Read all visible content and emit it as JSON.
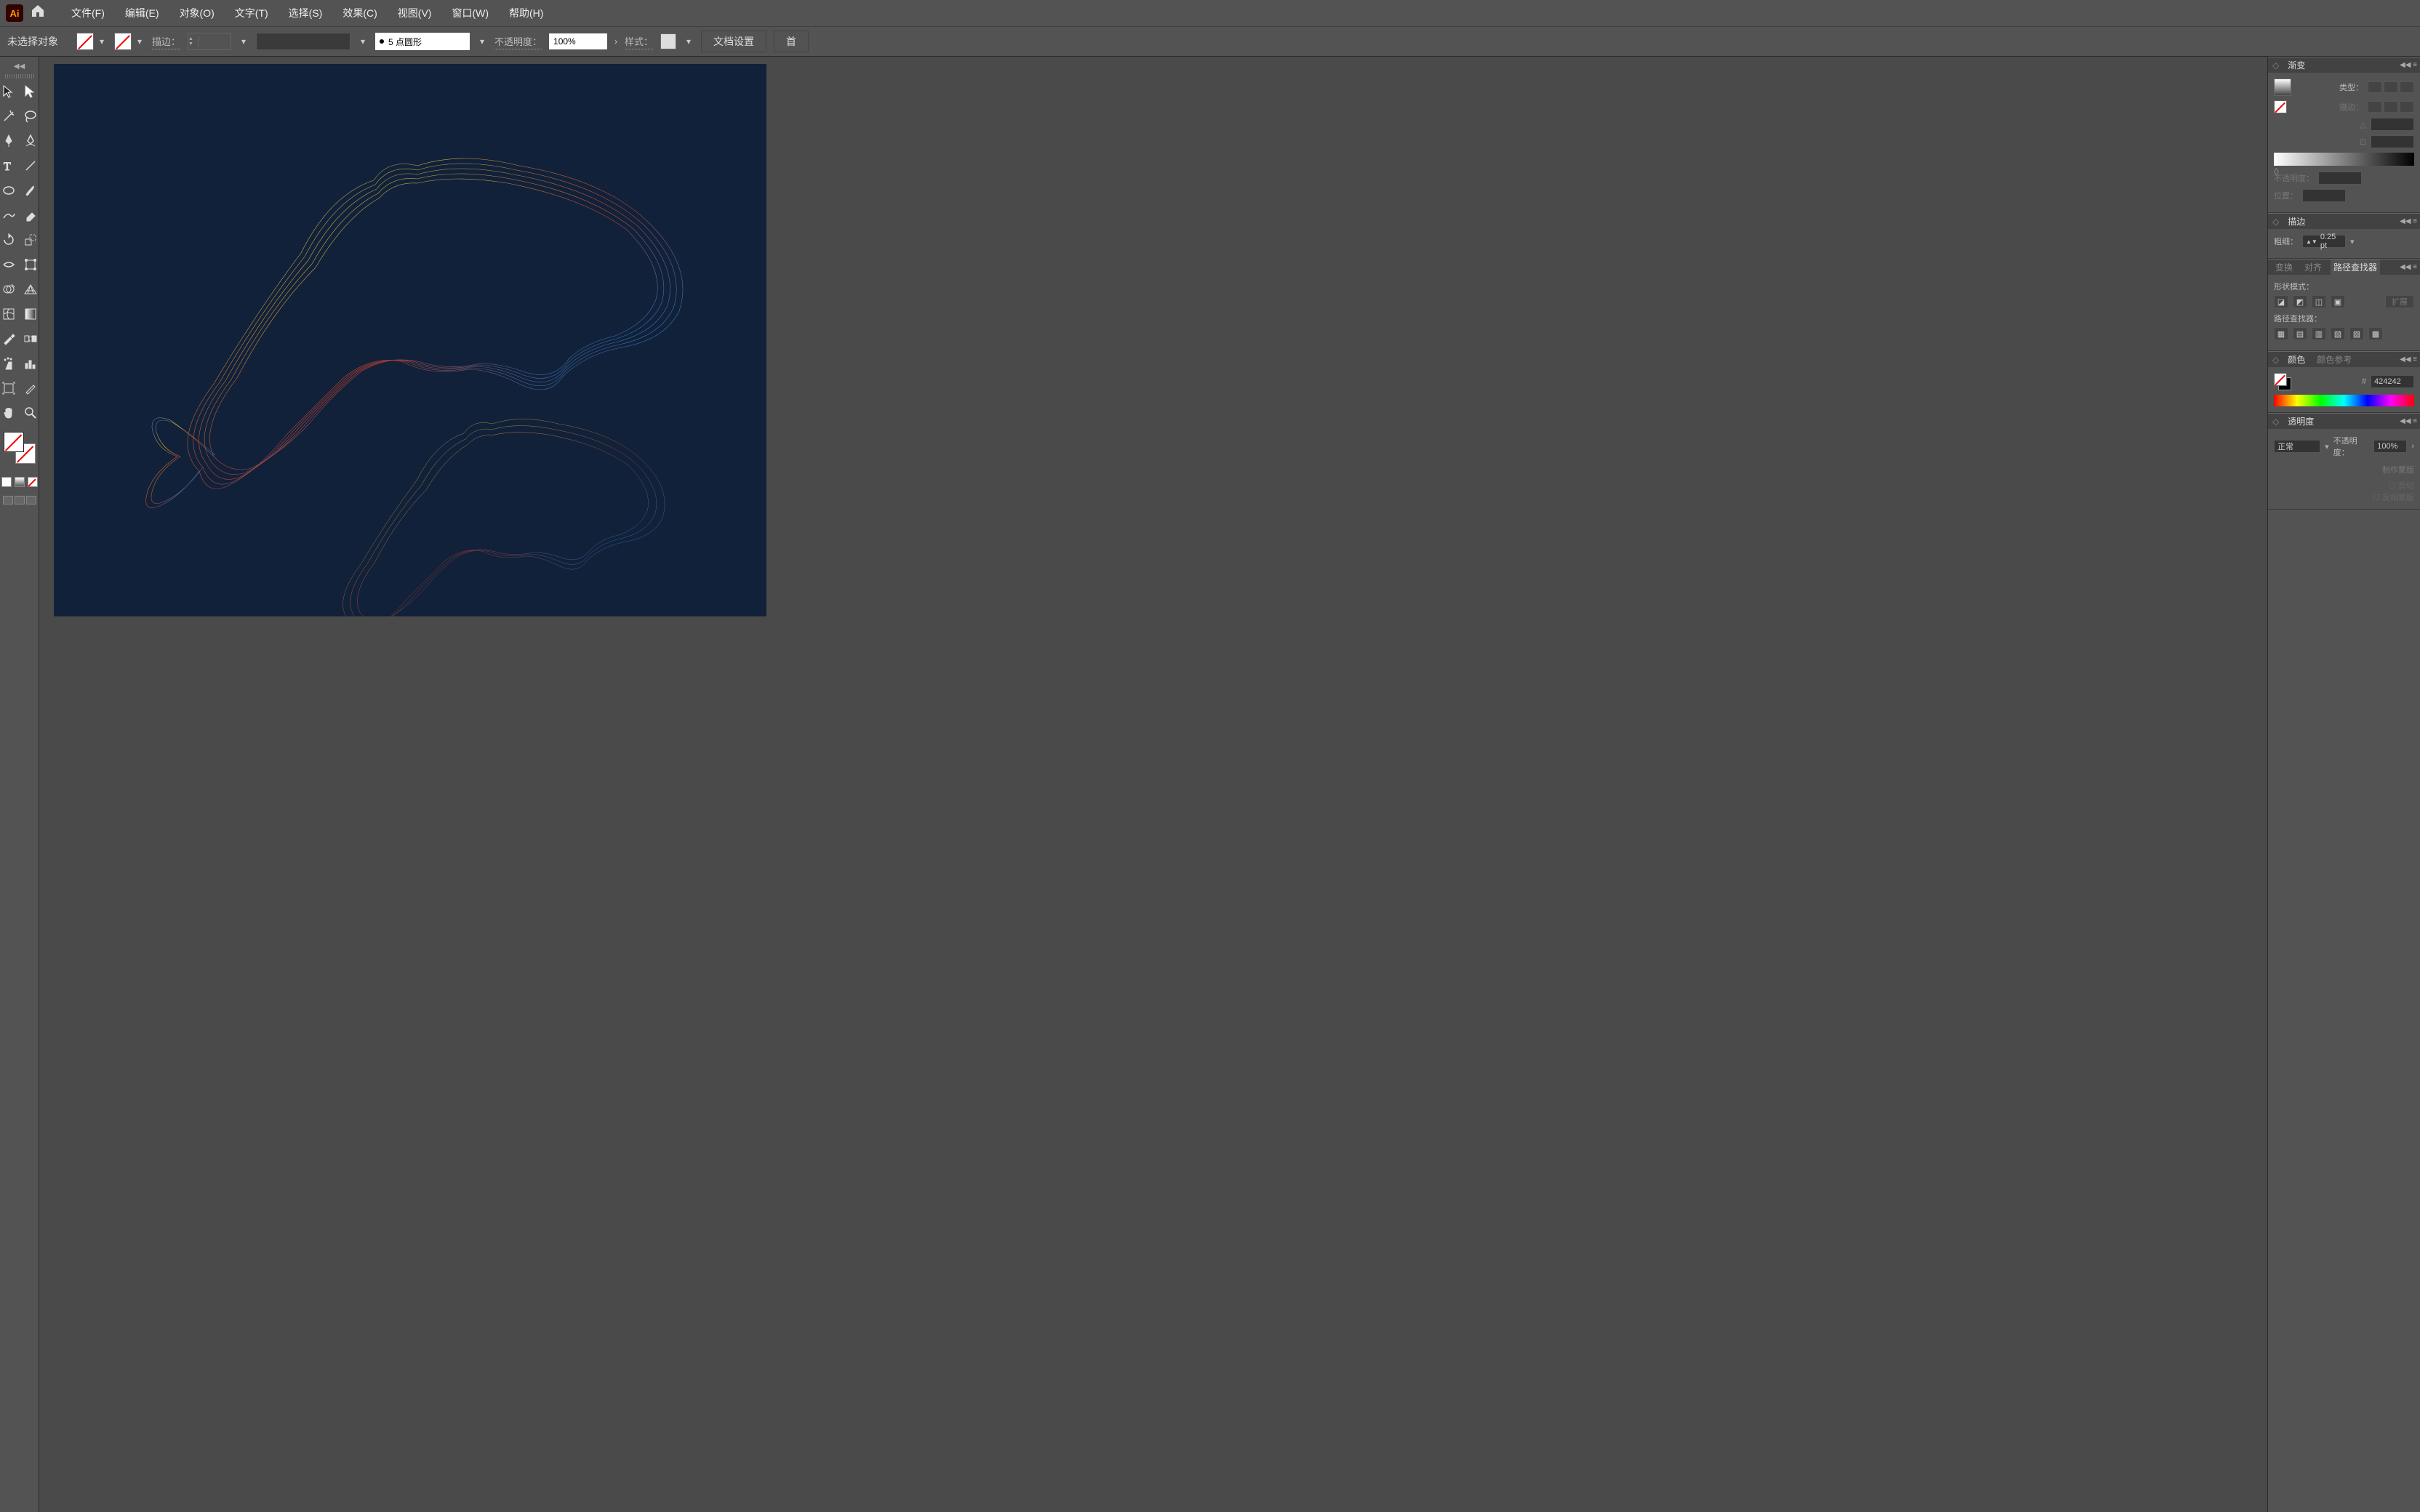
{
  "menu": {
    "items": [
      "文件(F)",
      "编辑(E)",
      "对象(O)",
      "文字(T)",
      "选择(S)",
      "效果(C)",
      "视图(V)",
      "窗口(W)",
      "帮助(H)"
    ]
  },
  "controlbar": {
    "noselection": "未选择对象",
    "stroke_label": "描边：",
    "brush_value": "5 点圆形",
    "opacity_label": "不透明度：",
    "opacity_value": "100%",
    "style_label": "样式：",
    "doc_setup": "文档设置",
    "prefs": "首"
  },
  "tools": {
    "names": [
      "selection-tool",
      "direct-selection-tool",
      "magic-wand-tool",
      "lasso-tool",
      "pen-tool",
      "curvature-tool",
      "type-tool",
      "line-tool",
      "ellipse-tool",
      "brush-tool",
      "shaper-tool",
      "eraser-tool",
      "rotate-tool",
      "scale-tool",
      "width-tool",
      "free-transform-tool",
      "shape-builder-tool",
      "perspective-tool",
      "mesh-tool",
      "gradient-tool",
      "eyedropper-tool",
      "blend-tool",
      "symbol-sprayer-tool",
      "column-graph-tool",
      "artboard-tool",
      "slice-tool",
      "hand-tool",
      "zoom-tool"
    ]
  },
  "panels": {
    "gradient": {
      "title": "渐变",
      "type_label": "类型：",
      "stroke_label": "描边：",
      "opacity_label": "不透明度：",
      "position_label": "位置："
    },
    "stroke": {
      "title": "描边",
      "weight_label": "粗细：",
      "weight_value": "0.25 pt"
    },
    "align": {
      "tabs": [
        "变换",
        "对齐",
        "路径查找器"
      ],
      "shape_mode": "形状模式：",
      "pathfinder": "路径查找器：",
      "expand": "扩展"
    },
    "color": {
      "tabs": [
        "颜色",
        "颜色参考"
      ],
      "hex": "424242"
    },
    "transparency": {
      "title": "透明度",
      "blend": "正常",
      "opac_label": "不透明度：",
      "opac_value": "100%",
      "make_mask": "制作蒙版",
      "clip": "剪切",
      "invert": "反相蒙版"
    }
  }
}
